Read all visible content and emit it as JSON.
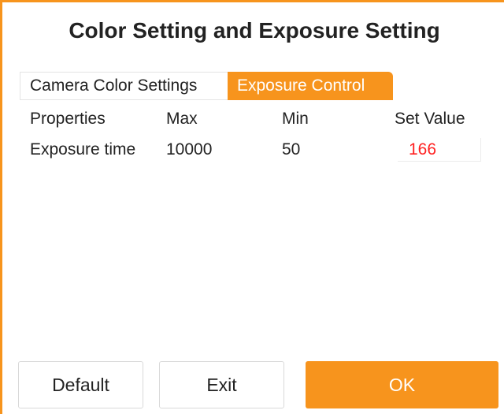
{
  "dialog": {
    "title": "Color Setting and Exposure Setting"
  },
  "tabs": [
    {
      "label": "Camera Color Settings",
      "active": false
    },
    {
      "label": "Exposure Control",
      "active": true
    }
  ],
  "table": {
    "headers": [
      "Properties",
      "Max",
      "Min",
      "Set Value"
    ],
    "rows": [
      {
        "property": "Exposure time",
        "max": "10000",
        "min": "50",
        "set_value": "166"
      }
    ]
  },
  "buttons": {
    "default_label": "Default",
    "exit_label": "Exit",
    "ok_label": "OK"
  },
  "colors": {
    "accent": "#f7941d",
    "value_text": "#ff2020"
  }
}
